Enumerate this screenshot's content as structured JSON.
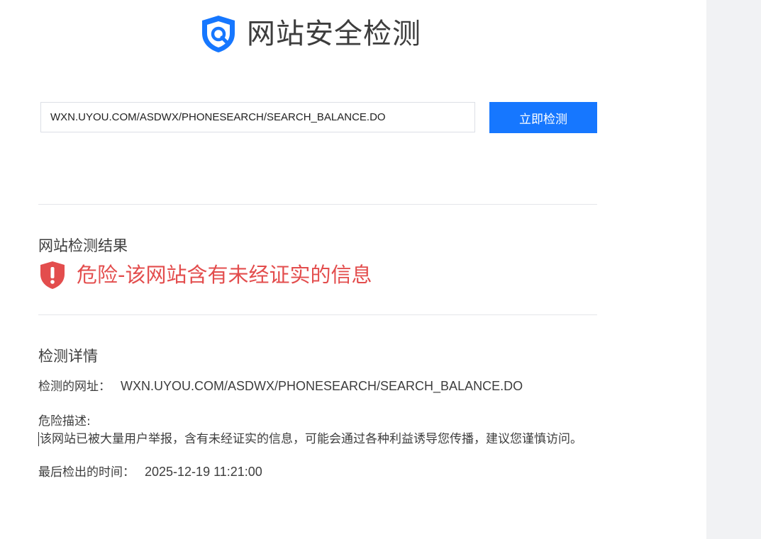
{
  "header": {
    "logo_icon": "shield-search-icon",
    "title": "网站安全检测"
  },
  "search": {
    "value": "WXN.UYOU.COM/ASDWX/PHONESEARCH/SEARCH_BALANCE.DO",
    "button_label": "立即检测"
  },
  "result": {
    "section_title": "网站检测结果",
    "status_icon": "warning-shield-icon",
    "status_text": "危险-该网站含有未经证实的信息",
    "status_color": "#e34d4d"
  },
  "details": {
    "section_title": "检测详情",
    "url_label": "检测的网址：",
    "url_value": "WXN.UYOU.COM/ASDWX/PHONESEARCH/SEARCH_BALANCE.DO",
    "risk_label": "危险描述:",
    "risk_description": "该网站已被大量用户举报，含有未经证实的信息，可能会通过各种利益诱导您传播，建议您谨慎访问。",
    "time_label": "最后检出的时间：",
    "time_value": "2025-12-19 11:21:00"
  },
  "colors": {
    "accent": "#1677ff",
    "danger": "#e34d4d",
    "side_panel": "#f1f2f4"
  }
}
